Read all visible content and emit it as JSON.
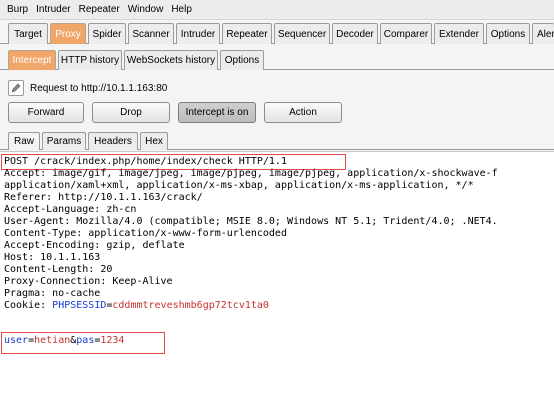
{
  "menu": [
    "Burp",
    "Intruder",
    "Repeater",
    "Window",
    "Help"
  ],
  "main_tabs": [
    "Target",
    "Proxy",
    "Spider",
    "Scanner",
    "Intruder",
    "Repeater",
    "Sequencer",
    "Decoder",
    "Comparer",
    "Extender",
    "Options",
    "Aler"
  ],
  "main_active": "Proxy",
  "proxy_tabs": [
    "Intercept",
    "HTTP history",
    "WebSockets history",
    "Options"
  ],
  "proxy_active": "Intercept",
  "request_label": "Request to http://10.1.1.163:80",
  "buttons": {
    "forward": "Forward",
    "drop": "Drop",
    "intercept": "Intercept is on",
    "action": "Action"
  },
  "view_tabs": [
    "Raw",
    "Params",
    "Headers",
    "Hex"
  ],
  "view_active": "Raw",
  "request_lines": [
    "POST /crack/index.php/home/index/check HTTP/1.1",
    "Accept: image/gif, image/jpeg, image/pjpeg, image/pjpeg, application/x-shockwave-f",
    "application/xaml+xml, application/x-ms-xbap, application/x-ms-application, */*",
    "Referer: http://10.1.1.163/crack/",
    "Accept-Language: zh-cn",
    "User-Agent: Mozilla/4.0 (compatible; MSIE 8.0; Windows NT 5.1; Trident/4.0; .NET4.",
    "Content-Type: application/x-www-form-urlencoded",
    "Accept-Encoding: gzip, deflate",
    "Host: 10.1.1.163",
    "Content-Length: 20",
    "Proxy-Connection: Keep-Alive",
    "Pragma: no-cache"
  ],
  "cookie": {
    "prefix": "Cookie: ",
    "name": "PHPSESSID",
    "eq": "=",
    "value": "cddmmtreveshmb6gp72tcv1ta0"
  },
  "body": {
    "k1": "user",
    "eq1": "=",
    "v1": "hetian",
    "amp": "&",
    "k2": "pas",
    "eq2": "=",
    "v2": "1234"
  },
  "colors": {
    "accent_tab": "#f0a668",
    "highlight_box": "#e34a4a",
    "param_name": "#1a3dd6",
    "param_value": "#c8312f"
  }
}
